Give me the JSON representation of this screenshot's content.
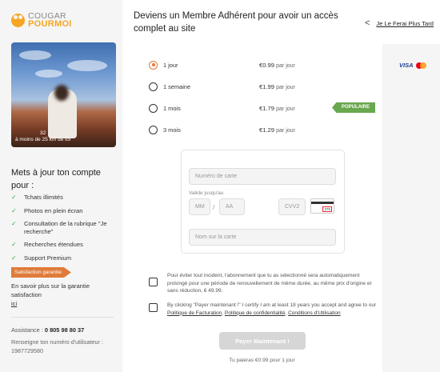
{
  "brand": {
    "line1": "COUGAR",
    "line2": "POURMOI"
  },
  "profile": {
    "photo_count": "32",
    "distance": "à moins de 25 km de toi"
  },
  "sidebar": {
    "title": "Mets à jour ton compte pour :",
    "features": [
      "Tchats illimités",
      "Photos en plein écran",
      "Consultation de la rubrique \"Je recherche\"",
      "Recherches étendues",
      "Support Premium"
    ],
    "guarantee_badge": "Satisfaction garantie",
    "guarantee_text": "En savoir plus sur la garantie satisfaction",
    "guarantee_link": "ici",
    "assist_label": "Assistance :",
    "assist_phone": "0 805 98 80 37",
    "user_number_label": "Renseigne ton numéro d'utilisateur :",
    "user_number": "1987729580"
  },
  "header": {
    "title": "Deviens un Membre Adhérent pour avoir un accès complet au site",
    "later_link": "Je Le Ferai Plus Tard"
  },
  "plans": [
    {
      "label": "1 jour",
      "price": "€0.99",
      "per": "par jour",
      "selected": true
    },
    {
      "label": "1 semaine",
      "price": "€1.99",
      "per": "par jour",
      "selected": false
    },
    {
      "label": "1 mois",
      "price": "€1.79",
      "per": "par jour",
      "selected": false,
      "badge": "POPULAIRE"
    },
    {
      "label": "3 mois",
      "price": "€1.29",
      "per": "par jour",
      "selected": false
    }
  ],
  "payment": {
    "visa": "VISA"
  },
  "card_form": {
    "number_placeholder": "Numéro de carte",
    "expiry_label": "Valide jusqu'au",
    "month_placeholder": "MM",
    "year_placeholder": "AA",
    "cvv_placeholder": "CVV2",
    "cvv_hint": "275",
    "name_placeholder": "Nom sur la carte"
  },
  "terms": {
    "auto_renew": "Pour éviter tout incident, l'abonnement que tu as sélectionné sera automatiquement prolongé pour une période de renouvellement de même durée, au même prix d'origine et sans réduction, € 49.99.",
    "certify_prefix": "By clicking \"Payer maintenant !\" I certify I am at least 18 years you accept and agree to our",
    "billing_link": "Politique de Facturation",
    "privacy_link": "Politique de confidentialité",
    "conditions_link": "Conditions d'Utilisation"
  },
  "pay": {
    "button": "Payer Maintenant !",
    "note": "Tu paieras €0.99 pour 1 jour"
  }
}
